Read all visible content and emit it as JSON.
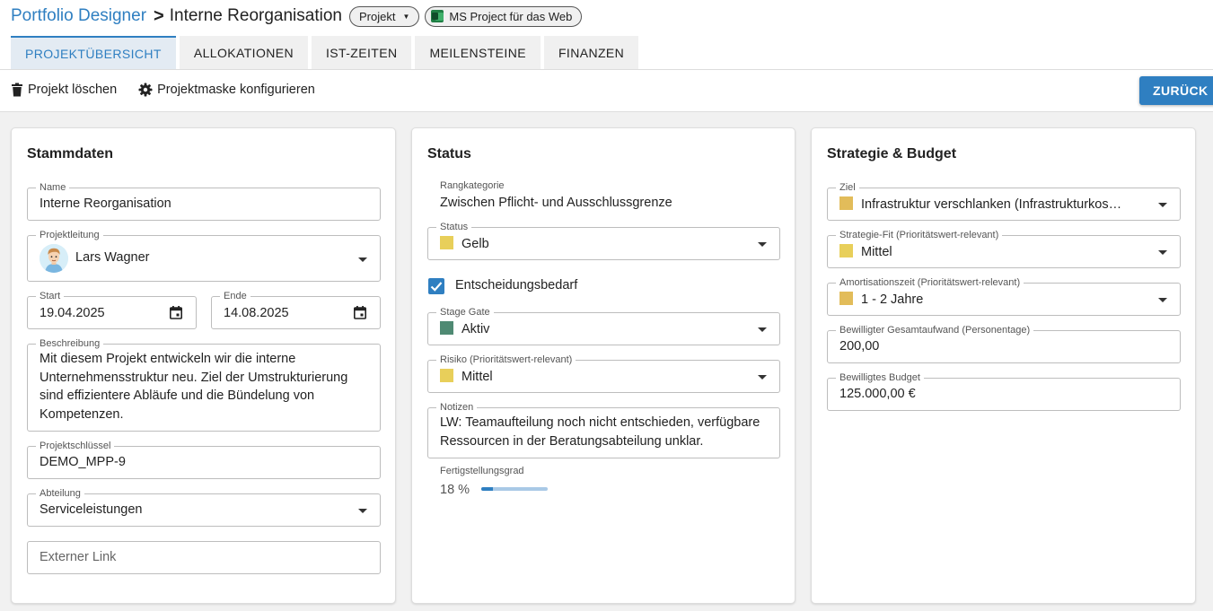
{
  "header": {
    "app_name": "Portfolio Designer",
    "separator": ">",
    "project_title": "Interne Reorganisation",
    "type_chip": "Projekt",
    "ms_chip": "MS Project für das Web"
  },
  "tabs": [
    {
      "label": "PROJEKTÜBERSICHT",
      "active": true
    },
    {
      "label": "ALLOKATIONEN",
      "active": false
    },
    {
      "label": "IST-ZEITEN",
      "active": false
    },
    {
      "label": "MEILENSTEINE",
      "active": false
    },
    {
      "label": "FINANZEN",
      "active": false
    }
  ],
  "toolbar": {
    "delete_label": "Projekt löschen",
    "configure_label": "Projektmaske konfigurieren",
    "back_label": "ZURÜCK"
  },
  "stammdaten": {
    "title": "Stammdaten",
    "name_label": "Name",
    "name_value": "Interne Reorganisation",
    "lead_label": "Projektleitung",
    "lead_value": "Lars Wagner",
    "start_label": "Start",
    "start_value": "19.04.2025",
    "end_label": "Ende",
    "end_value": "14.08.2025",
    "description_label": "Beschreibung",
    "description_value": "Mit diesem Projekt entwickeln wir die interne Unternehmensstruktur neu. Ziel der Umstrukturierung sind effizientere Abläufe und die Bündelung von Kompetenzen.",
    "key_label": "Projektschlüssel",
    "key_value": "DEMO_MPP-9",
    "department_label": "Abteilung",
    "department_value": "Serviceleistungen",
    "link_placeholder": "Externer Link"
  },
  "status": {
    "title": "Status",
    "rank_label": "Rangkategorie",
    "rank_value": "Zwischen Pflicht- und Ausschlussgrenze",
    "status_label": "Status",
    "status_value": "Gelb",
    "status_color": "#e8cf5a",
    "decision_label": "Entscheidungsbedarf",
    "decision_checked": true,
    "gate_label": "Stage Gate",
    "gate_value": "Aktiv",
    "gate_color": "#4f8a73",
    "risk_label": "Risiko (Prioritätswert-relevant)",
    "risk_value": "Mittel",
    "risk_color": "#e8cf5a",
    "notes_label": "Notizen",
    "notes_value": "LW: Teamaufteilung noch nicht entschieden, verfügbare Ressourcen in der Beratungsabteilung unklar.",
    "progress_label": "Fertigstellungsgrad",
    "progress_text": "18 %",
    "progress_fraction": 0.18
  },
  "strategy": {
    "title": "Strategie & Budget",
    "goal_label": "Ziel",
    "goal_value": "Infrastruktur verschlanken (Infrastrukturkos…",
    "goal_color": "#e2bc5a",
    "fit_label": "Strategie-Fit (Prioritätswert-relevant)",
    "fit_value": "Mittel",
    "fit_color": "#e8cf5a",
    "amort_label": "Amortisationszeit (Prioritätswert-relevant)",
    "amort_value": "1 - 2 Jahre",
    "amort_color": "#e2bc5a",
    "effort_label": "Bewilligter Gesamtaufwand (Personentage)",
    "effort_value": "200,00",
    "budget_label": "Bewilligtes Budget",
    "budget_value": "125.000,00 €"
  },
  "colors": {
    "accent": "#2f7fc1"
  }
}
